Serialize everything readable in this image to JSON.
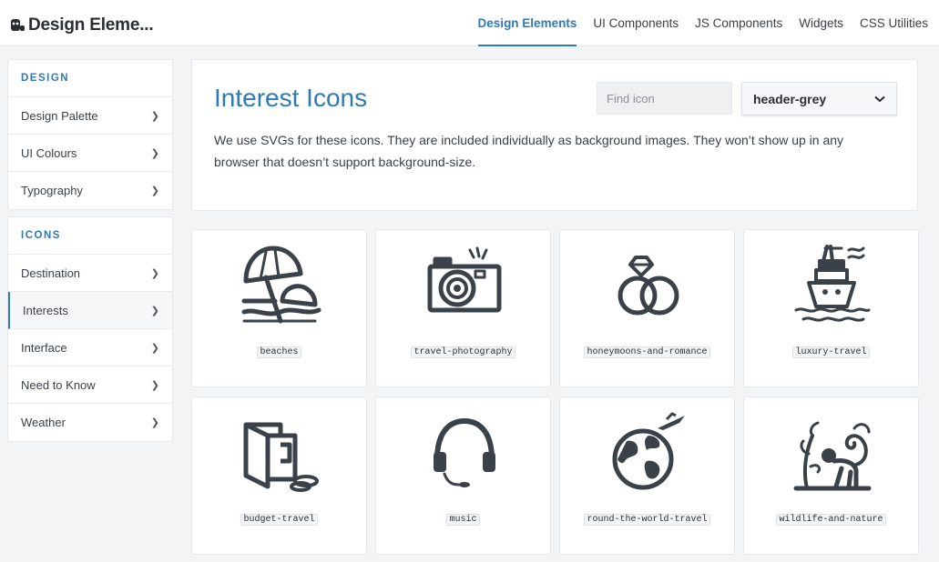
{
  "header": {
    "title": "Design Eleme...",
    "nav": [
      "Design Elements",
      "UI Components",
      "JS Components",
      "Widgets",
      "CSS Utilities"
    ],
    "active_nav": "Design Elements"
  },
  "sidebar": {
    "design": {
      "heading": "DESIGN",
      "items": [
        "Design Palette",
        "UI Colours",
        "Typography"
      ]
    },
    "icons": {
      "heading": "ICONS",
      "items": [
        "Destination",
        "Interests",
        "Interface",
        "Need to Know",
        "Weather"
      ],
      "active": "Interests"
    }
  },
  "main": {
    "title": "Interest Icons",
    "description": "We use SVGs for these icons. They are included individually as background images. They won’t show up in any browser that doesn’t support background-size.",
    "search": {
      "placeholder": "Find icon",
      "value": ""
    },
    "color_select": {
      "value": "header-grey"
    },
    "icons": [
      "beaches",
      "travel-photography",
      "honeymoons-and-romance",
      "luxury-travel",
      "budget-travel",
      "music",
      "round-the-world-travel",
      "wildlife-and-nature"
    ]
  },
  "colors": {
    "accent": "#2d7ab8",
    "icon": "#3a4148",
    "background": "#f3f4f6"
  }
}
